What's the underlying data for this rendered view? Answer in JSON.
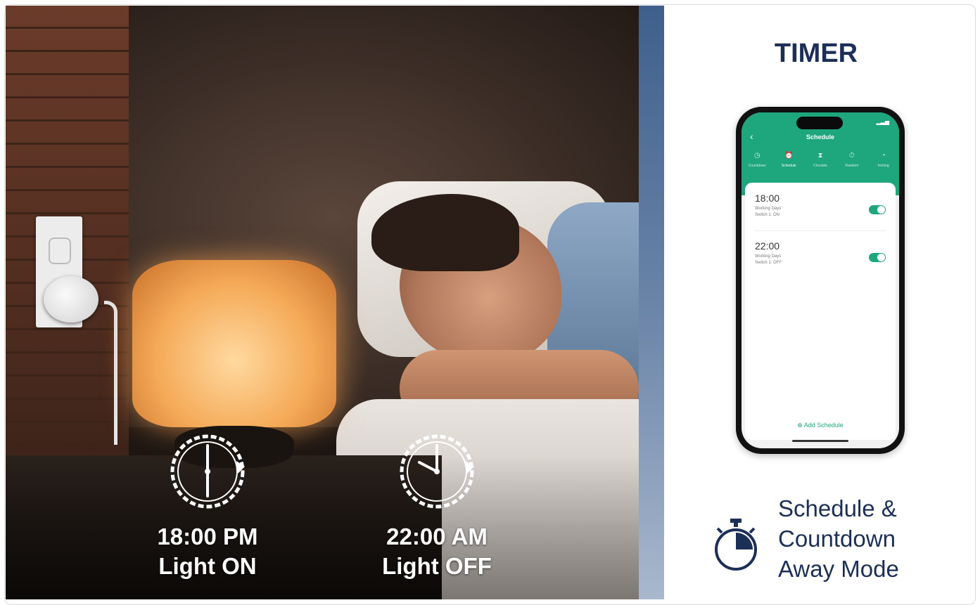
{
  "left": {
    "clock_on": {
      "time": "18:00 PM",
      "state": "Light ON"
    },
    "clock_off": {
      "time": "22:00 AM",
      "state": "Light OFF"
    }
  },
  "right": {
    "title": "TIMER",
    "phone": {
      "header_title": "Schedule",
      "tabs": [
        {
          "label": "Countdown",
          "icon": "clock-icon"
        },
        {
          "label": "Schedule",
          "icon": "alarm-icon"
        },
        {
          "label": "Circulate",
          "icon": "hourglass-icon"
        },
        {
          "label": "Random",
          "icon": "timer-icon"
        },
        {
          "label": "Inching",
          "icon": "gauge-icon"
        }
      ],
      "active_tab": "Schedule",
      "schedules": [
        {
          "time": "18:00",
          "days": "Working Days",
          "switch": "Switch 1: ON",
          "enabled": true
        },
        {
          "time": "22:00",
          "days": "Working Days",
          "switch": "Switch 1: OFF",
          "enabled": true
        }
      ],
      "add_label": "Add Schedule"
    },
    "features": [
      "Schedule &",
      "Countdown",
      "Away Mode"
    ]
  },
  "colors": {
    "navy": "#1c2f57",
    "app_green": "#1ea67d"
  }
}
